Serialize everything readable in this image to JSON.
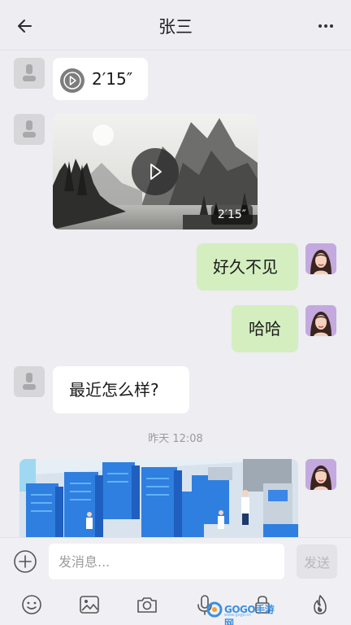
{
  "header": {
    "title": "张三",
    "back_icon": "arrow-left-icon",
    "more_icon": "more-dots-icon"
  },
  "messages": [
    {
      "type": "voice",
      "side": "left",
      "duration": "2′15″"
    },
    {
      "type": "video",
      "side": "left",
      "duration": "2′15″"
    },
    {
      "type": "text",
      "side": "right",
      "text": "好久不见"
    },
    {
      "type": "text",
      "side": "right",
      "text": "哈哈"
    },
    {
      "type": "text",
      "side": "left",
      "text": "最近怎么样?"
    },
    {
      "type": "image",
      "side": "right"
    }
  ],
  "time_separator": "昨天 12:08",
  "input": {
    "placeholder": "发消息...",
    "send_label": "发送"
  },
  "toolbar": {
    "icons": [
      "emoji-icon",
      "image-icon",
      "camera-icon",
      "microphone-icon",
      "lock-icon",
      "fire-icon"
    ]
  },
  "watermark": {
    "text": "GOGO手游网",
    "sub": "www.gogo.cn"
  },
  "colors": {
    "background": "#ededf2",
    "bubble_right": "#d4eec0",
    "bubble_left": "#ffffff",
    "avatar_placeholder": "#d7d7d9"
  }
}
